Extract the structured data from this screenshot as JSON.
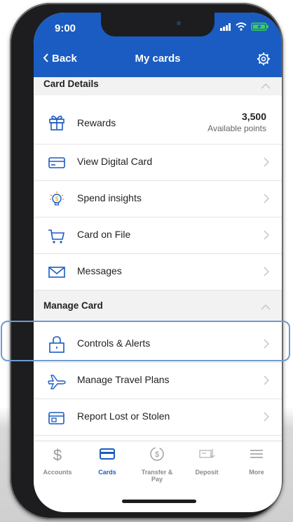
{
  "status": {
    "time": "9:00"
  },
  "nav": {
    "back_label": "Back",
    "title": "My cards"
  },
  "sections": {
    "card_details": "Card Details",
    "manage_card": "Manage Card"
  },
  "rewards": {
    "label": "Rewards",
    "points": "3,500",
    "points_sub": "Available points"
  },
  "rows": {
    "view_digital_card": "View Digital Card",
    "spend_insights": "Spend insights",
    "card_on_file": "Card on File",
    "messages": "Messages",
    "controls_alerts": "Controls & Alerts",
    "manage_travel": "Manage Travel Plans",
    "report_lost": "Report Lost or Stolen"
  },
  "tabs": {
    "accounts": "Accounts",
    "cards": "Cards",
    "transfer_pay": "Transfer & Pay",
    "deposit": "Deposit",
    "more": "More"
  },
  "colors": {
    "brand_blue": "#1a5cc2",
    "highlight": "#6d9bd1"
  },
  "icons": [
    "gift-icon",
    "card-icon",
    "lightbulb-icon",
    "cart-icon",
    "envelope-icon",
    "lock-icon",
    "airplane-icon",
    "wallet-icon",
    "dollar-icon",
    "refresh-dollar-icon",
    "check-deposit-icon",
    "menu-icon",
    "gear-icon",
    "chevron-right-icon",
    "chevron-up-icon"
  ]
}
